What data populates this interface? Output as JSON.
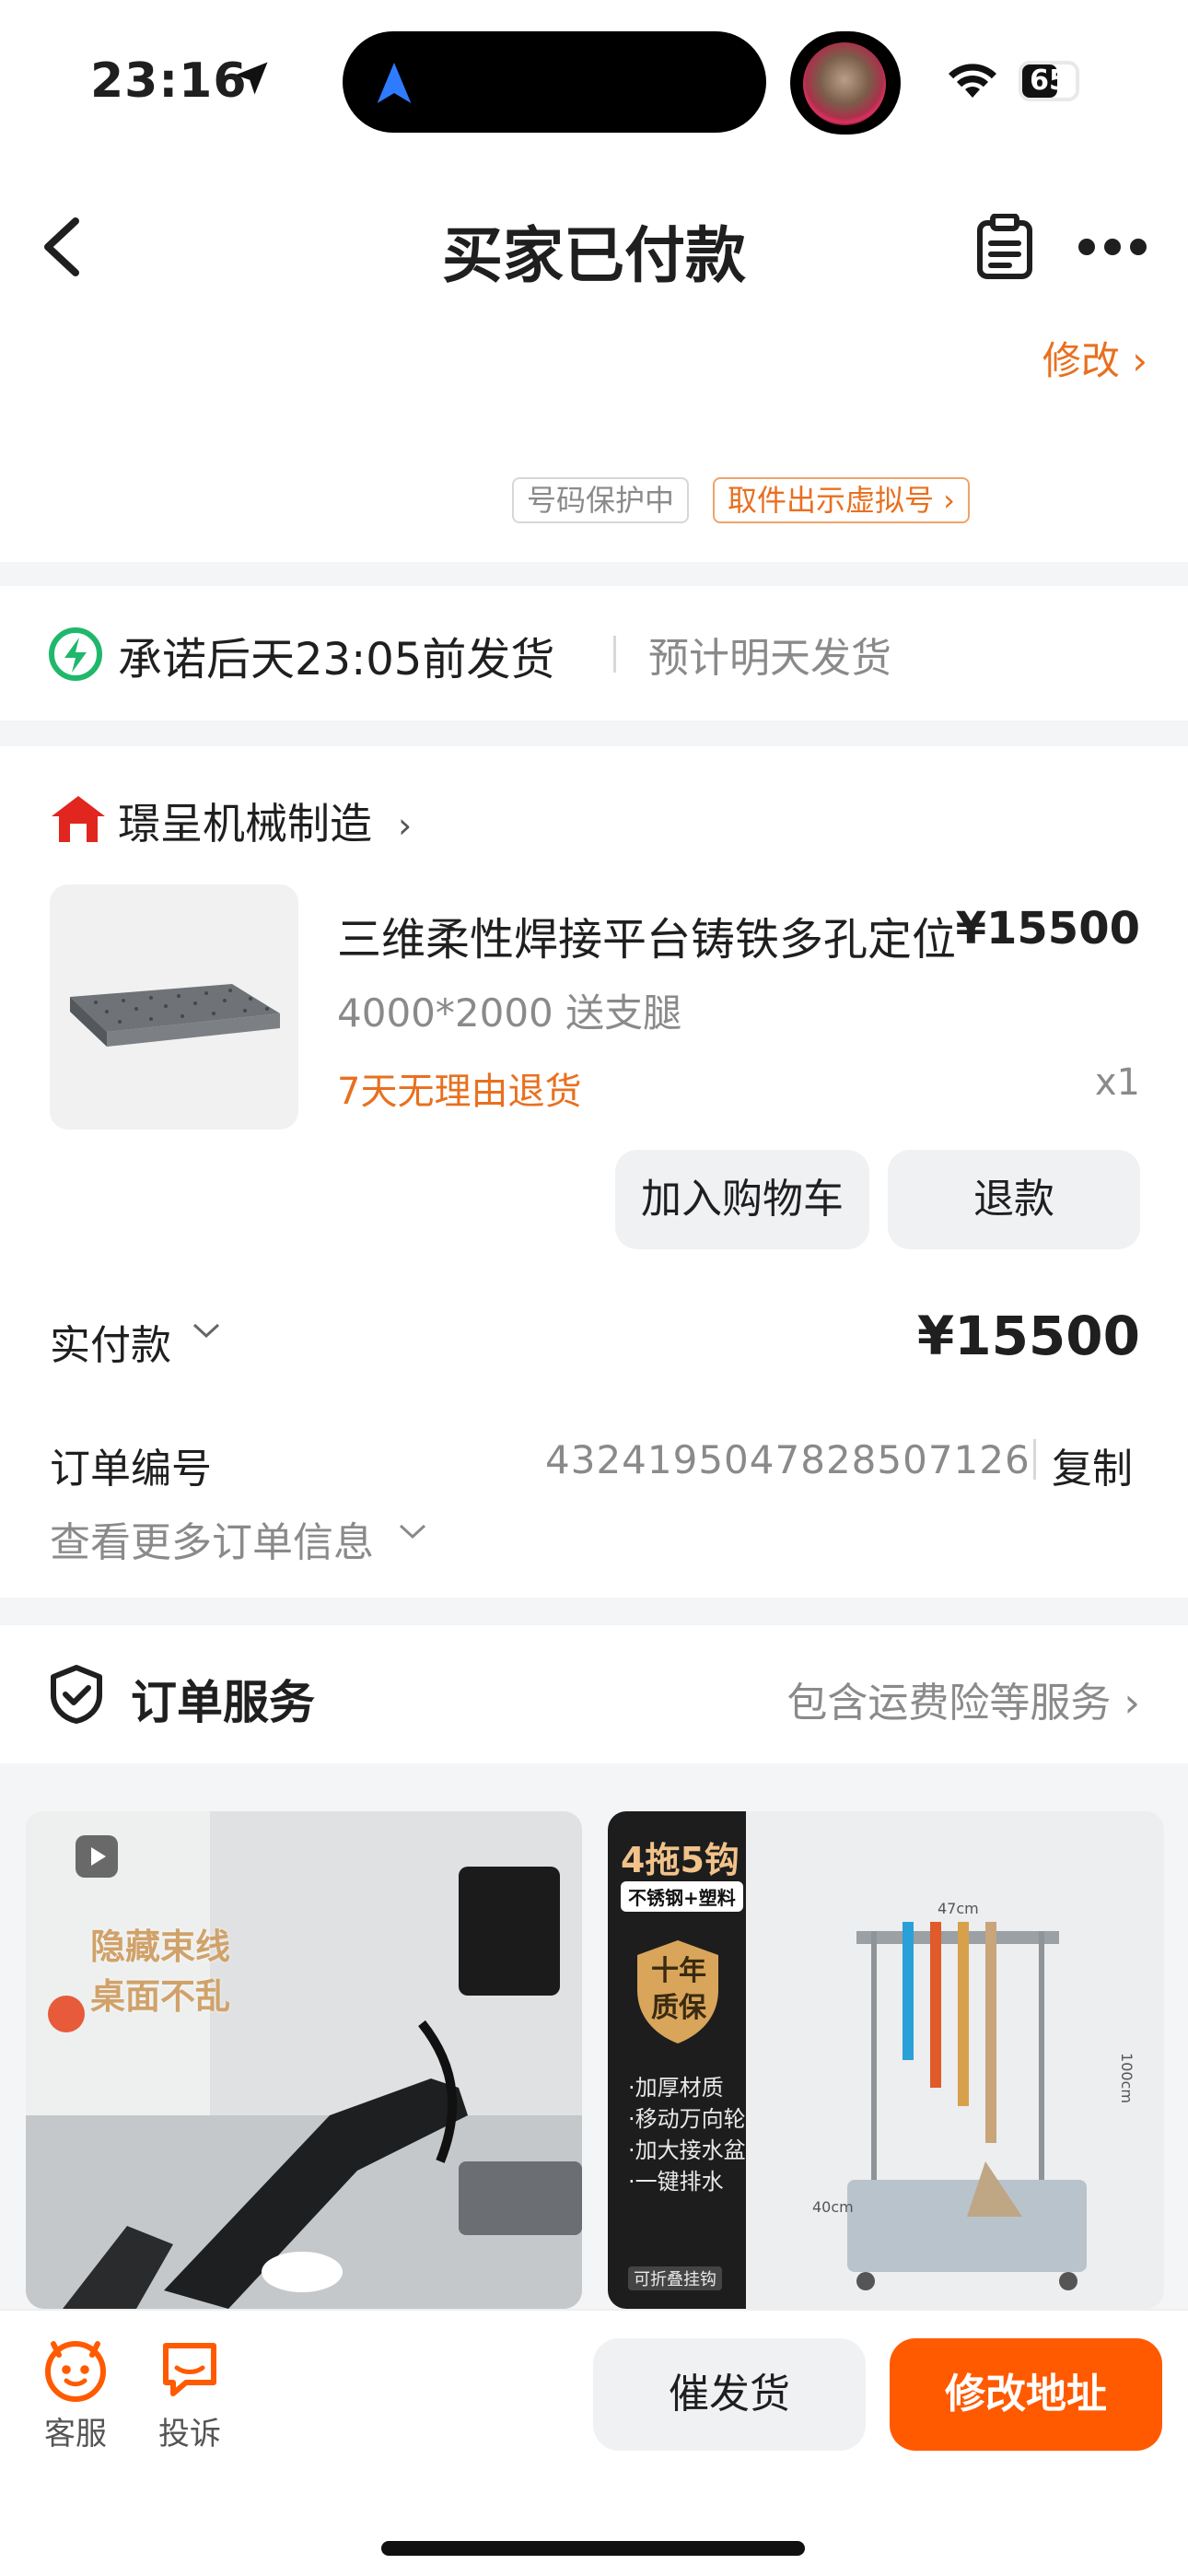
{
  "status_bar": {
    "time": "23:16",
    "battery": "65"
  },
  "nav": {
    "title": "买家已付款"
  },
  "address": {
    "edit_label": "修改 ›",
    "protect_label": "号码保护中",
    "virtual_label": "取件出示虚拟号 ›"
  },
  "shipping": {
    "promise": "承诺后天23:05前发货",
    "estimate": "预计明天发货"
  },
  "shop": {
    "name": "璟呈机械制造",
    "chevron": "›"
  },
  "product": {
    "title": "三维柔性焊接平台铸铁多孔定位",
    "price": "¥15500",
    "spec": "4000*2000 送支腿",
    "return_policy": "7天无理由退货",
    "quantity": "x1"
  },
  "actions": {
    "add_cart": "加入购物车",
    "refund": "退款"
  },
  "payment": {
    "label": "实付款",
    "amount": "¥15500"
  },
  "order_no": {
    "label": "订单编号",
    "value": "4324195047828507126",
    "copy": "复制"
  },
  "more_info": "查看更多订单信息",
  "service": {
    "title": "订单服务",
    "link": "包含运费险等服务 ›"
  },
  "recommend": {
    "card1_caption_1": "隐藏束线",
    "card1_caption_2": "桌面不乱",
    "card2_tag": "4拖5钩",
    "card2_material": "不锈钢+塑料",
    "card2_badge_1": "十年",
    "card2_badge_2": "质保",
    "card2_features": [
      "·加厚材质",
      "·移动万向轮",
      "·加大接水盆",
      "·一键排水"
    ],
    "card2_dim_w": "47cm",
    "card2_dim_h": "100cm",
    "card2_dim_d": "40cm",
    "card2_fold": "可折叠挂钩"
  },
  "bottom_bar": {
    "service": "客服",
    "complaint": "投诉",
    "urge": "催发货",
    "change_address": "修改地址"
  },
  "colors": {
    "accent": "#ff5a00",
    "orange_text": "#e8701f",
    "green": "#1fb86b"
  }
}
